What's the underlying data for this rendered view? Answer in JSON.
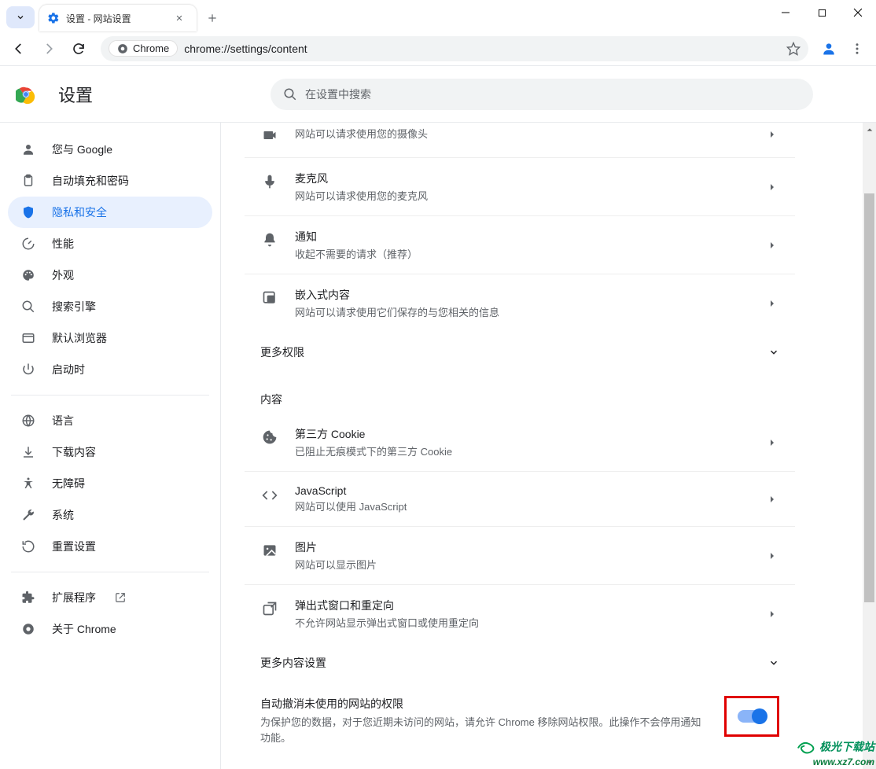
{
  "window": {
    "tab_title": "设置 - 网站设置"
  },
  "toolbar": {
    "chip_label": "Chrome",
    "url": "chrome://settings/content"
  },
  "appbar": {
    "title": "设置",
    "search_placeholder": "在设置中搜索"
  },
  "sidebar": {
    "items": [
      {
        "label": "您与 Google"
      },
      {
        "label": "自动填充和密码"
      },
      {
        "label": "隐私和安全"
      },
      {
        "label": "性能"
      },
      {
        "label": "外观"
      },
      {
        "label": "搜索引擎"
      },
      {
        "label": "默认浏览器"
      },
      {
        "label": "启动时"
      },
      {
        "label": "语言"
      },
      {
        "label": "下载内容"
      },
      {
        "label": "无障碍"
      },
      {
        "label": "系统"
      },
      {
        "label": "重置设置"
      },
      {
        "label": "扩展程序"
      },
      {
        "label": "关于 Chrome"
      }
    ]
  },
  "permissions": {
    "camera": {
      "title": "",
      "desc": "网站可以请求使用您的摄像头"
    },
    "mic": {
      "title": "麦克风",
      "desc": "网站可以请求使用您的麦克风"
    },
    "notif": {
      "title": "通知",
      "desc": "收起不需要的请求（推荐）"
    },
    "embed": {
      "title": "嵌入式内容",
      "desc": "网站可以请求使用它们保存的与您相关的信息"
    },
    "more": {
      "label": "更多权限"
    }
  },
  "content_section": {
    "label": "内容",
    "cookie": {
      "title": "第三方 Cookie",
      "desc": "已阻止无痕模式下的第三方 Cookie"
    },
    "js": {
      "title": "JavaScript",
      "desc": "网站可以使用 JavaScript"
    },
    "img": {
      "title": "图片",
      "desc": "网站可以显示图片"
    },
    "popup": {
      "title": "弹出式窗口和重定向",
      "desc": "不允许网站显示弹出式窗口或使用重定向"
    },
    "more": {
      "label": "更多内容设置"
    }
  },
  "auto_revoke": {
    "title": "自动撤消未使用的网站的权限",
    "desc": "为保护您的数据，对于您近期未访问的网站，请允许 Chrome 移除网站权限。此操作不会停用通知功能。"
  },
  "watermark": {
    "line1": "极光下载站",
    "line2": "www.xz7.com"
  }
}
